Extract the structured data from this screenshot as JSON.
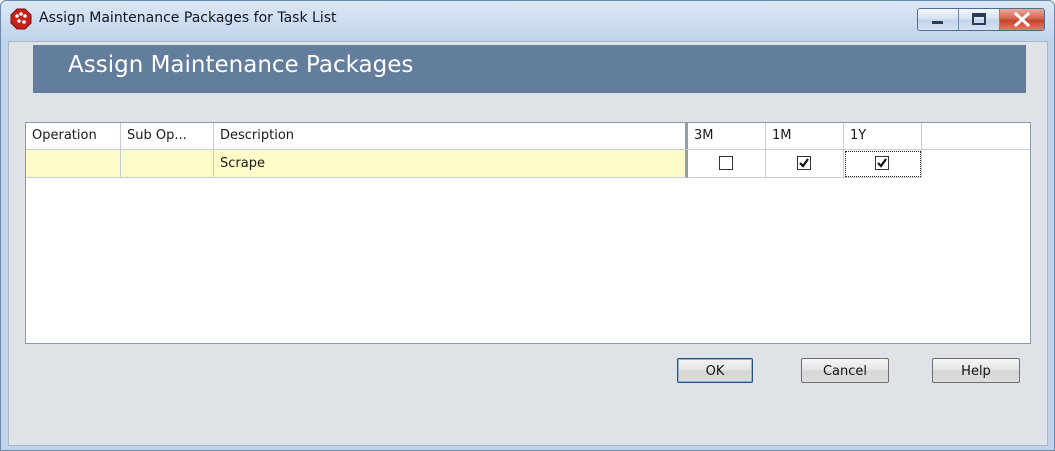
{
  "window": {
    "title": "Assign Maintenance Packages for Task List",
    "app_icon": "red-octagon-app-icon",
    "controls": {
      "minimize_icon": "minimize-icon",
      "maximize_icon": "maximize-icon",
      "close_icon": "close-icon"
    }
  },
  "banner": {
    "title": "Assign Maintenance Packages"
  },
  "grid": {
    "columns": [
      {
        "label": "Operation"
      },
      {
        "label": "Sub Op..."
      },
      {
        "label": "Description"
      },
      {
        "label": "3M"
      },
      {
        "label": "1M"
      },
      {
        "label": "1Y"
      }
    ],
    "rows": [
      {
        "operation": "",
        "sub_operation": "",
        "description": "Scrape",
        "checks": {
          "3M": false,
          "1M": true,
          "1Y": true
        },
        "focused_column": "1Y"
      }
    ]
  },
  "buttons": {
    "ok": "OK",
    "cancel": "Cancel",
    "help": "Help"
  },
  "colors": {
    "banner": "#637d9c",
    "row_highlight": "#fdfcc9",
    "window_frame": "#c9daef",
    "close_button": "#c4452c"
  }
}
